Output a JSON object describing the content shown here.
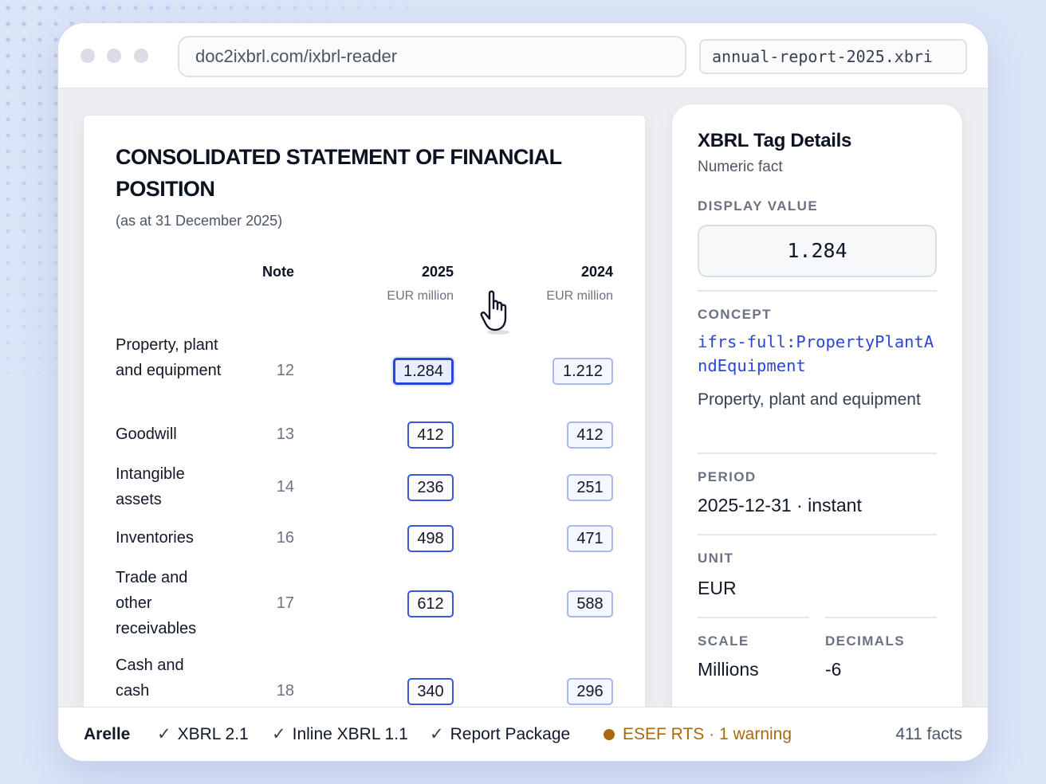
{
  "browser": {
    "url": "doc2ixbrl.com/ixbrl-reader",
    "file_name": "annual-report-2025.xbri"
  },
  "statement": {
    "title": "CONSOLIDATED STATEMENT OF FINANCIAL POSITION",
    "subtitle": "(as at 31 December 2025)",
    "columns": {
      "note": "Note",
      "current": {
        "year": "2025",
        "unit": "EUR million"
      },
      "prior": {
        "year": "2024",
        "unit": "EUR million"
      }
    },
    "rows": [
      {
        "label": "Property, plant and equipment",
        "note": "12",
        "current": "1.284",
        "prior": "1.212"
      },
      {
        "label": "Goodwill",
        "note": "13",
        "current": "412",
        "prior": "412"
      },
      {
        "label": "Intangible assets",
        "note": "14",
        "current": "236",
        "prior": "251"
      },
      {
        "label": "Inventories",
        "note": "16",
        "current": "498",
        "prior": "471"
      },
      {
        "label": "Trade and other receivables",
        "note": "17",
        "current": "612",
        "prior": "588"
      },
      {
        "label": "Cash and cash",
        "note": "18",
        "current": "340",
        "prior": "296"
      }
    ]
  },
  "tag_details": {
    "title": "XBRL Tag Details",
    "subtitle": "Numeric fact",
    "display_value_label": "DISPLAY VALUE",
    "display_value": "1.284",
    "concept_label": "CONCEPT",
    "concept_code": "ifrs-full:PropertyPlantAndEquipment",
    "concept_desc": "Property, plant and equipment",
    "period_label": "PERIOD",
    "period": "2025-12-31 · instant",
    "unit_label": "UNIT",
    "unit": "EUR",
    "scale_label": "SCALE",
    "scale": "Millions",
    "decimals_label": "DECIMALS",
    "decimals": "-6"
  },
  "status": {
    "brand": "Arelle",
    "checks": [
      "XBRL 2.1",
      "Inline XBRL 1.1",
      "Report Package"
    ],
    "warning": "ESEF RTS · 1 warning",
    "warning_color": "#a86a0c",
    "facts": "411 facts"
  },
  "colors": {
    "accent": "#2c46d6",
    "selected_border": "#2747d8"
  }
}
